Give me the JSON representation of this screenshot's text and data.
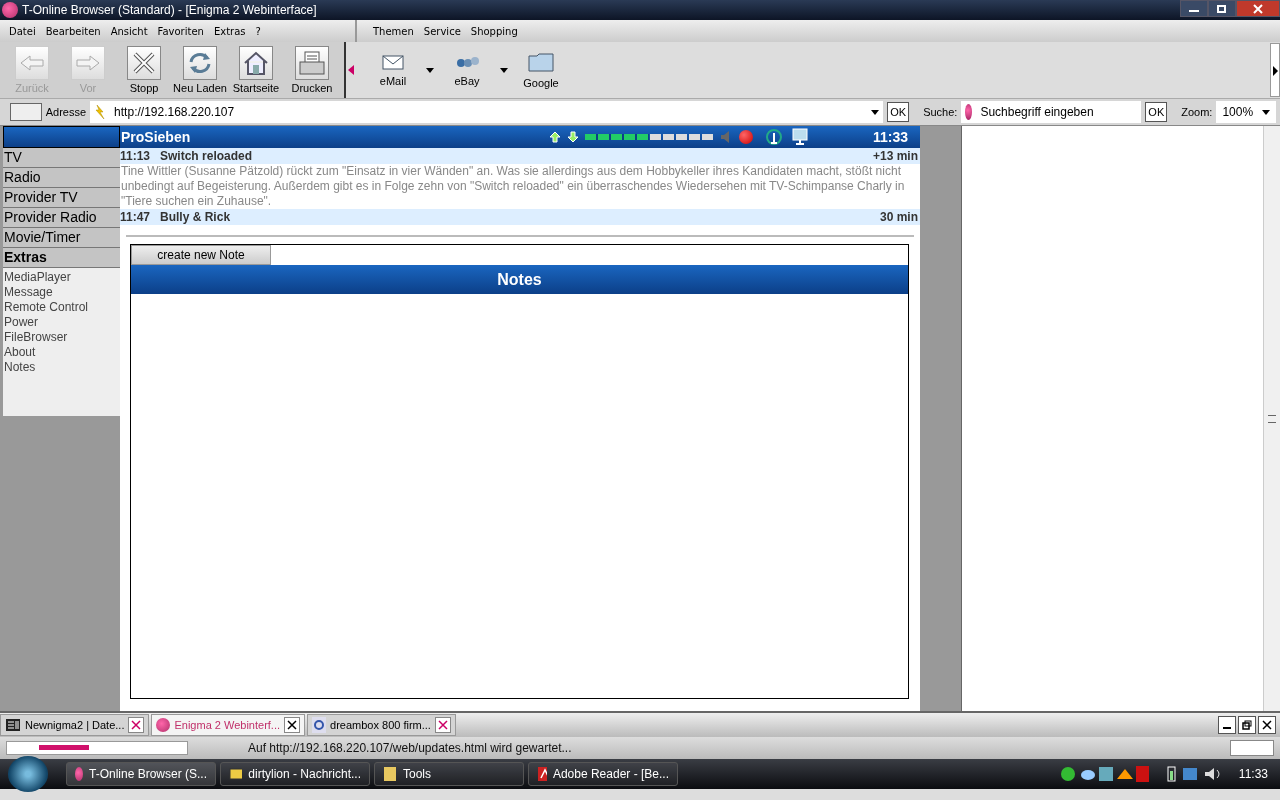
{
  "window": {
    "title": "T-Online Browser (Standard) - [Enigma 2 Webinterface]"
  },
  "menu": [
    "Datei",
    "Bearbeiten",
    "Ansicht",
    "Favoriten",
    "Extras",
    "?"
  ],
  "menu_right": [
    "Themen",
    "Service",
    "Shopping"
  ],
  "toolbar": [
    {
      "kind": "back",
      "label": "Zurück",
      "disabled": true
    },
    {
      "kind": "forward",
      "label": "Vor",
      "disabled": true
    },
    {
      "kind": "stop",
      "label": "Stopp",
      "disabled": false
    },
    {
      "kind": "reload",
      "label": "Neu Laden",
      "disabled": false
    },
    {
      "kind": "home",
      "label": "Startseite",
      "disabled": false
    },
    {
      "kind": "print",
      "label": "Drucken",
      "disabled": false
    }
  ],
  "portal_links": [
    {
      "kind": "mail",
      "label": "eMail"
    },
    {
      "kind": "ebay",
      "label": "eBay"
    },
    {
      "kind": "my",
      "label": "Google"
    }
  ],
  "address_bar": {
    "label": "Adresse",
    "value": "http://192.168.220.107",
    "ok": "OK",
    "search_label": "Suche:",
    "search_placeholder": "Suchbegriff eingeben",
    "search_ok": "OK",
    "zoom_label": "Zoom:",
    "zoom_value": "100%"
  },
  "webif": {
    "channel": "ProSieben",
    "time": "11:33",
    "signal": {
      "level": 0.5
    },
    "sidebar": [
      {
        "label": "TV",
        "selected": false
      },
      {
        "label": "Radio",
        "selected": false
      },
      {
        "label": "Provider TV",
        "selected": false
      },
      {
        "label": "Provider Radio",
        "selected": false
      },
      {
        "label": "Movie/Timer",
        "selected": false
      },
      {
        "label": "Extras",
        "selected": true
      }
    ],
    "submenu": [
      "MediaPlayer",
      "Message",
      "Remote Control",
      "Power",
      "FileBrowser",
      "About",
      "Notes"
    ],
    "epg": [
      {
        "time": "11:13",
        "title": "Switch reloaded",
        "duration": "+13 min",
        "description": "Tine Wittler (Susanne Pätzold) rückt zum \"Einsatz in vier Wänden\" an. Was sie allerdings aus dem Hobbykeller ihres Kandidaten macht, stößt nicht unbedingt auf Begeisterung. Außerdem gibt es in Folge zehn von \"Switch reloaded\" ein überraschendes Wiedersehen mit TV-Schimpanse Charly in \"Tiere suchen ein Zuhause\"."
      },
      {
        "time": "11:47",
        "title": "Bully & Rick",
        "duration": "30 min"
      }
    ],
    "notes": {
      "button": "create new Note",
      "title": "Notes"
    }
  },
  "browser_tabs": [
    {
      "label": "Newnigma2 | Date...",
      "selected": false
    },
    {
      "label": "Enigma 2 Webinterf...",
      "selected": true
    },
    {
      "label": "dreambox 800 firm...",
      "selected": false
    }
  ],
  "status_bar": {
    "text": "Auf http://192.168.220.107/web/updates.html wird gewartet..."
  },
  "taskbar": {
    "items": [
      "T-Online Browser (S...",
      "dirtylion - Nachricht...",
      "Tools",
      "Adobe Reader - [Be..."
    ],
    "clock": "11:33"
  }
}
